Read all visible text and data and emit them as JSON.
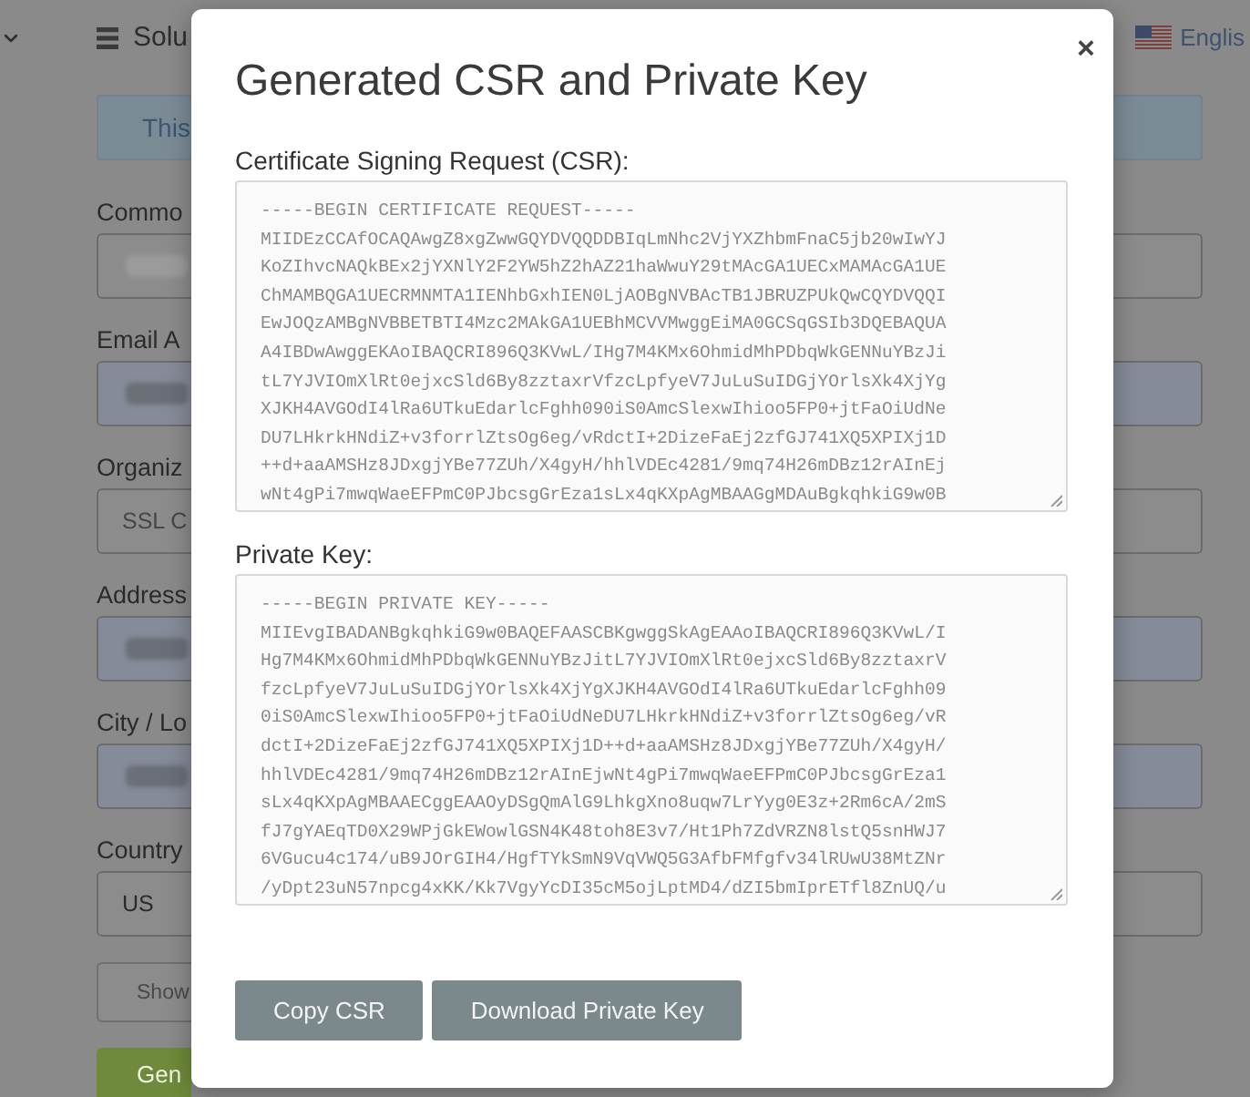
{
  "background_page": {
    "header": {
      "title": "Solu",
      "language": "Englis"
    },
    "notice": "This",
    "form_fields": [
      {
        "label": "Commo",
        "autofilled": false,
        "value_blurred": true
      },
      {
        "label": "Email A",
        "autofilled": true,
        "value_blurred": true
      },
      {
        "label": "Organiz",
        "autofilled": false,
        "placeholder": "SSL C"
      },
      {
        "label": "Address",
        "autofilled": true,
        "value_blurred": true
      },
      {
        "label": "City / Lo",
        "autofilled": true,
        "value_blurred": true
      },
      {
        "label": "Country",
        "autofilled": false,
        "value": "US"
      }
    ],
    "buttons": [
      {
        "label": "Show",
        "kind": "outline"
      },
      {
        "label": "Gen",
        "kind": "primary"
      }
    ]
  },
  "dialog": {
    "title": "Generated CSR and Private Key",
    "close": "×",
    "sections": [
      {
        "label": "Certificate Signing Request (CSR):",
        "text": "-----BEGIN CERTIFICATE REQUEST-----\nMIIDEzCCAfOCAQAwgZ8xgZwwGQYDVQQDDBIqLmNhc2VjYXZhbmFnaC5jb20wIwYJ\nKoZIhvcNAQkBEx2jYXNlY2F2YW5hZ2hAZ21haWwuY29tMAcGA1UECxMAMAcGA1UE\nChMAMBQGA1UECRMNMTA1IENhbGxhIEN0LjAOBgNVBAcTB1JBRUZPUkQwCQYDVQQI\nEwJOQzAMBgNVBBETBTI4Mzc2MAkGA1UEBhMCVVMwggEiMA0GCSqGSIb3DQEBAQUA\nA4IBDwAwggEKAoIBAQCRI896Q3KVwL/IHg7M4KMx6OhmidMhPDbqWkGENNuYBzJi\ntL7YJVIOmXlRt0ejxcSld6By8zztaxrVfzcLpfyeV7JuLuSuIDGjYOrlsXk4XjYg\nXJKH4AVGOdI4lRa6UTkuEdarlcFghh090iS0AmcSlexwIhioo5FP0+jtFaOiUdNe\nDU7LHkrkHNdiZ+v3forrlZtsOg6eg/vRdctI+2DizeFaEj2zfGJ741XQ5XPIXj1D\n++d+aaAMSHz8JDxgjYBe77ZUh/X4gyH/hhlVDEc4281/9mq74H26mDBz12rAInEj\nwNt4gPi7mwqWaeEFPmC0PJbcsgGrEza1sLx4qKXpAgMBAAGgMDAuBgkqhkiG9w0B"
      },
      {
        "label": "Private Key:",
        "text": "-----BEGIN PRIVATE KEY-----\nMIIEvgIBADANBgkqhkiG9w0BAQEFAASCBKgwggSkAgEAAoIBAQCRI896Q3KVwL/I\nHg7M4KMx6OhmidMhPDbqWkGENNuYBzJitL7YJVIOmXlRt0ejxcSld6By8zztaxrV\nfzcLpfyeV7JuLuSuIDGjYOrlsXk4XjYgXJKH4AVGOdI4lRa6UTkuEdarlcFghh09\n0iS0AmcSlexwIhioo5FP0+jtFaOiUdNeDU7LHkrkHNdiZ+v3forrlZtsOg6eg/vR\ndctI+2DizeFaEj2zfGJ741XQ5XPIXj1D++d+aaAMSHz8JDxgjYBe77ZUh/X4gyH/\nhhlVDEc4281/9mq74H26mDBz12rAInEjwNt4gPi7mwqWaeEFPmC0PJbcsgGrEza1\nsLx4qKXpAgMBAAECggEAAOyDSgQmAlG9LhkgXno8uqw7LrYyg0E3z+2Rm6cA/2mS\nfJ7gYAEqTD0X29WPjGkEWowlGSN4K48toh8E3v7/Ht1Ph7ZdVRZN8lstQ5snHWJ7\n6VGucu4c174/uB9JOrGIH4/HgfTYkSmN9VqVWQ5G3AfbFMfgfv34lRUwU38MtZNr\n/yDpt23uN57npcg4xKK/Kk7VgyYcDI35cM5ojLptMD4/dZI5bmIprETfl8ZnUQ/u"
      }
    ],
    "buttons": [
      "Copy CSR",
      "Download Private Key"
    ]
  }
}
